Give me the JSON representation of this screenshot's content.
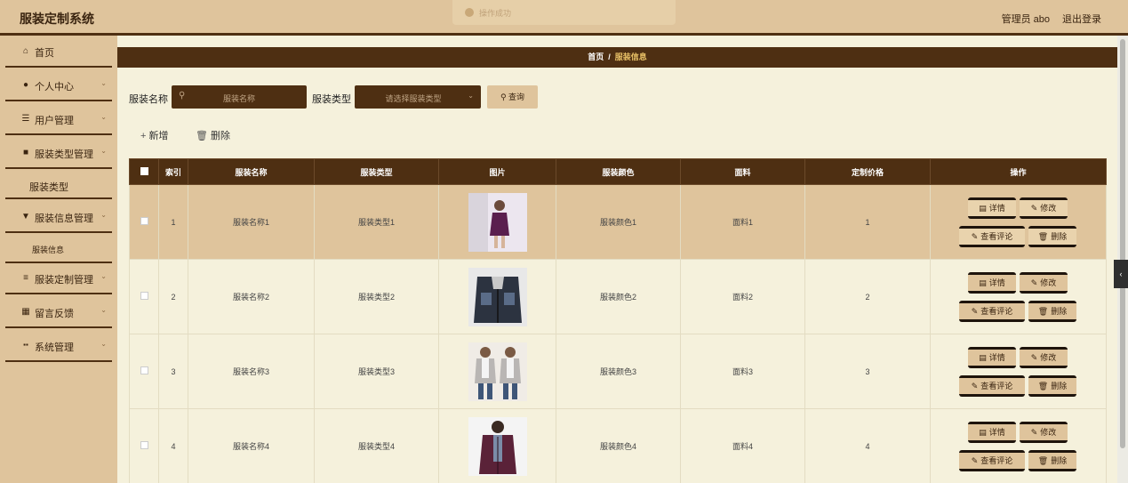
{
  "header": {
    "app_title": "服装定制系统",
    "user_label": "管理员 abo",
    "logout_label": "退出登录"
  },
  "toast": {
    "text": "操作成功"
  },
  "sidebar": {
    "items": [
      {
        "label": "首页",
        "icon": "home-icon",
        "glyph": "⌂",
        "arrow": ""
      },
      {
        "label": "个人中心",
        "icon": "user-icon",
        "glyph": "●",
        "arrow": "⌄"
      },
      {
        "label": "用户管理",
        "icon": "sliders-icon",
        "glyph": "☰",
        "arrow": "⌄"
      },
      {
        "label": "服装类型管理",
        "icon": "briefcase-icon",
        "glyph": "■",
        "arrow": "⌄"
      },
      {
        "label": "服装类型",
        "sub": true
      },
      {
        "label": "服装信息管理",
        "icon": "trophy-icon",
        "glyph": "▼",
        "arrow": "⌄"
      },
      {
        "label": "服装信息",
        "sub": true
      },
      {
        "label": "服装定制管理",
        "icon": "list-icon",
        "glyph": "≡",
        "arrow": "⌄"
      },
      {
        "label": "留言反馈",
        "icon": "grid-icon",
        "glyph": "▦",
        "arrow": "⌄"
      },
      {
        "label": "系统管理",
        "icon": "apps-icon",
        "glyph": "▪▪",
        "arrow": "⌄"
      }
    ]
  },
  "breadcrumb": {
    "home": "首页",
    "sep": "/",
    "current": "服装信息"
  },
  "search": {
    "name_label": "服装名称",
    "name_placeholder": "服装名称",
    "type_label": "服装类型",
    "type_placeholder": "请选择服装类型",
    "query_label": "查询"
  },
  "actions": {
    "add_label": "新增",
    "delete_label": "删除"
  },
  "table": {
    "headers": [
      "索引",
      "服装名称",
      "服装类型",
      "图片",
      "服装颜色",
      "面料",
      "定制价格",
      "操作"
    ],
    "rows": [
      {
        "index": "1",
        "name": "服装名称1",
        "type": "服装类型1",
        "color": "服装颜色1",
        "fabric": "面料1",
        "price": "1"
      },
      {
        "index": "2",
        "name": "服装名称2",
        "type": "服装类型2",
        "color": "服装颜色2",
        "fabric": "面料2",
        "price": "2"
      },
      {
        "index": "3",
        "name": "服装名称3",
        "type": "服装类型3",
        "color": "服装颜色3",
        "fabric": "面料3",
        "price": "3"
      },
      {
        "index": "4",
        "name": "服装名称4",
        "type": "服装类型4",
        "color": "服装颜色4",
        "fabric": "面料4",
        "price": "4"
      }
    ],
    "ops": {
      "detail": "详情",
      "edit": "修改",
      "comments": "查看评论",
      "delete": "删除"
    }
  },
  "colors": {
    "brown": "#4e2f12",
    "tan": "#dfc49c",
    "cream": "#f5f1dc",
    "gold": "#e8c066"
  }
}
